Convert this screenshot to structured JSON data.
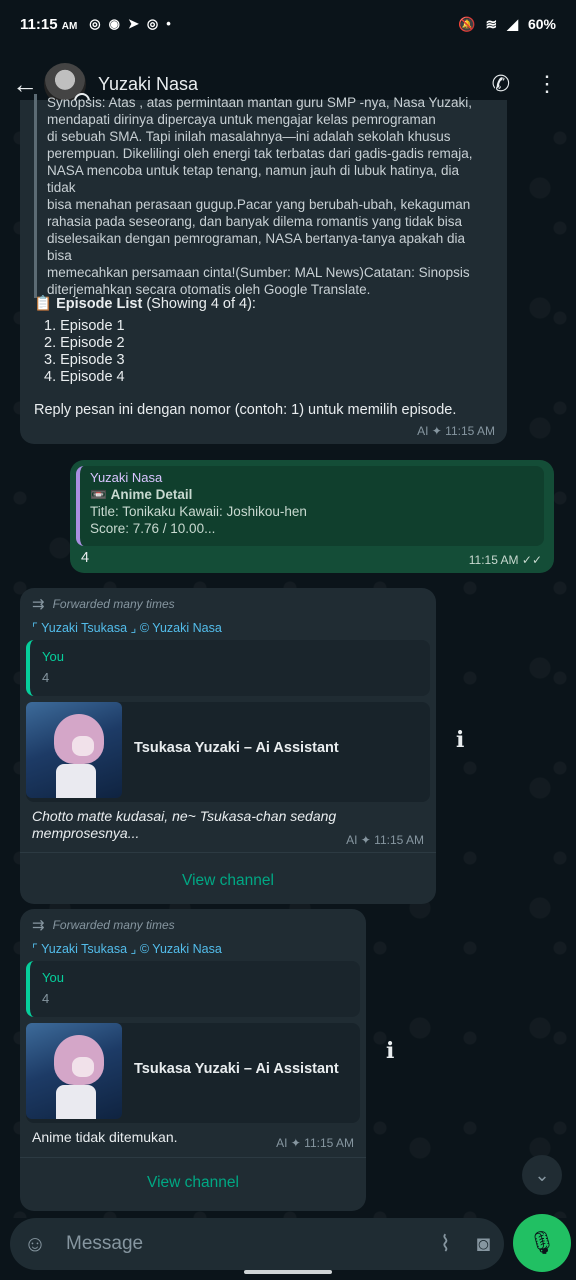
{
  "status_bar": {
    "time": "11:15",
    "ampm": "AM",
    "battery": "60%",
    "app_icons": [
      "whatsapp-icon",
      "discord-icon",
      "telegram-icon",
      "whatsapp-icon"
    ]
  },
  "header": {
    "contact_name": "Yuzaki Nasa"
  },
  "messages": {
    "m1": {
      "synopsis_lines": [
        "Synopsis: Atas , atas permintaan mantan guru SMP -nya, Nasa Yuzaki,",
        "mendapati dirinya dipercaya untuk mengajar kelas pemrograman",
        "di sebuah SMA. Tapi inilah masalahnya—ini adalah sekolah khusus",
        "perempuan. Dikelilingi oleh energi tak terbatas dari gadis-gadis remaja,",
        "NASA mencoba untuk tetap tenang, namun jauh di lubuk hatinya, dia tidak",
        "bisa menahan perasaan gugup.Pacar yang berubah-ubah, kekaguman",
        "rahasia pada seseorang, dan banyak dilema romantis yang tidak bisa",
        "diselesaikan dengan pemrograman, NASA bertanya-tanya apakah dia bisa",
        "memecahkan persamaan cinta!(Sumber: MAL News)Catatan: Sinopsis",
        "diterjemahkan secara otomatis oleh Google Translate."
      ],
      "episode_emoji": "📋",
      "episode_list_title": "Episode List",
      "episode_list_count": "(Showing 4 of 4):",
      "episodes": [
        "1. Episode 1",
        "2. Episode 2",
        "3. Episode 3",
        "4. Episode 4"
      ],
      "reply_prompt": "Reply pesan ini dengan nomor (contoh: 1) untuk memilih episode.",
      "meta": "AI ✦ 11:15 AM"
    },
    "m2": {
      "quote_name": "Yuzaki Nasa",
      "quote_title": "Anime Detail",
      "quote_title_emoji": "📼",
      "quote_line1": "Title: Tonikaku Kawaii: Joshikou-hen",
      "quote_line2": "Score: 7.76 / 10.00...",
      "text": "4",
      "meta": "11:15 AM",
      "ticks": "✓✓"
    },
    "m3": {
      "forwarded": "Forwarded many times",
      "channel": "⌜ Yuzaki Tsukasa ⌟ © Yuzaki Nasa",
      "quote_name": "You",
      "quote_value": "4",
      "card_title": "Tsukasa Yuzaki – Ai Assistant",
      "caption": "Chotto matte kudasai, ne~ Tsukasa-chan sedang memprosesnya...",
      "meta": "AI ✦ 11:15 AM",
      "view_channel": "View channel"
    },
    "m4": {
      "forwarded": "Forwarded many times",
      "channel": "⌜ Yuzaki Tsukasa ⌟ © Yuzaki Nasa",
      "quote_name": "You",
      "quote_value": "4",
      "card_title": "Tsukasa Yuzaki – Ai Assistant",
      "caption": "Anime tidak ditemukan.",
      "meta": "AI ✦ 11:15 AM",
      "view_channel": "View channel"
    }
  },
  "composer": {
    "placeholder": "Message"
  },
  "colors": {
    "background": "#0b141a",
    "incoming_bubble": "#202c33",
    "outgoing_bubble": "#144d37",
    "accent_green": "#00a884",
    "link_blue": "#53bdeb"
  }
}
